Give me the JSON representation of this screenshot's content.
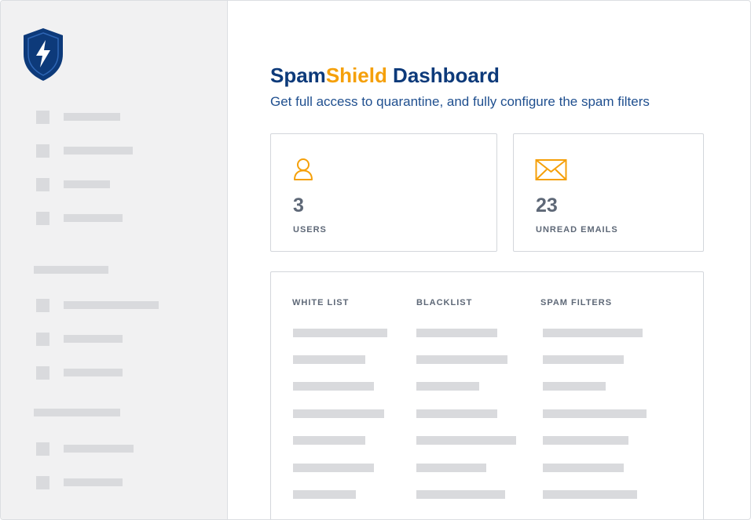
{
  "app": {
    "title_prefix": "Spam",
    "title_accent": "Shield",
    "title_suffix": " Dashboard",
    "subtitle": "Get full access to quarantine, and fully configure the spam filters"
  },
  "colors": {
    "brand_navy": "#0d3a7a",
    "accent_orange": "#f5a00a",
    "placeholder_gray": "#d9dadd",
    "sidebar_bg": "#f1f1f2"
  },
  "sidebar": {
    "logo_icon": "shield-lightning-icon"
  },
  "stats": [
    {
      "icon": "user-icon",
      "value": "3",
      "label": "USERS"
    },
    {
      "icon": "envelope-icon",
      "value": "23",
      "label": "UNREAD EMAILS"
    }
  ],
  "lists": {
    "columns": [
      {
        "header": "WHITE LIST"
      },
      {
        "header": "BLACKLIST"
      },
      {
        "header": "SPAM FILTERS"
      }
    ]
  }
}
